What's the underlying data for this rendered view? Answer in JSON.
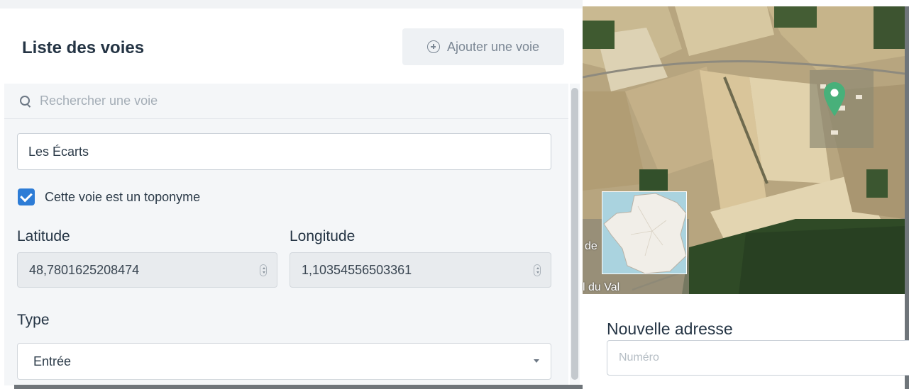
{
  "panel": {
    "title": "Liste des voies",
    "add_button_label": "Ajouter une voie"
  },
  "search": {
    "placeholder": "Rechercher une voie"
  },
  "form": {
    "name_value": "Les Écarts",
    "toponym_checkbox": {
      "label": "Cette voie est un toponyme",
      "checked": true
    },
    "latitude": {
      "label": "Latitude",
      "value": "48,7801625208474"
    },
    "longitude": {
      "label": "Longitude",
      "value": "1,10354556503361"
    },
    "type": {
      "label": "Type",
      "selected": "Entrée"
    }
  },
  "map": {
    "labels": {
      "left_fragment_1": "de",
      "left_fragment_2": "l du Val"
    },
    "marker_color": "#48b07a",
    "icons": [
      "search-icon",
      "plus-circle-icon",
      "map-marker-icon"
    ]
  },
  "new_address": {
    "title": "Nouvelle adresse",
    "number_placeholder": "Numéro"
  },
  "colors": {
    "accent": "#2d7cd6",
    "panel_bg": "#f4f6f8",
    "text": "#243444"
  }
}
